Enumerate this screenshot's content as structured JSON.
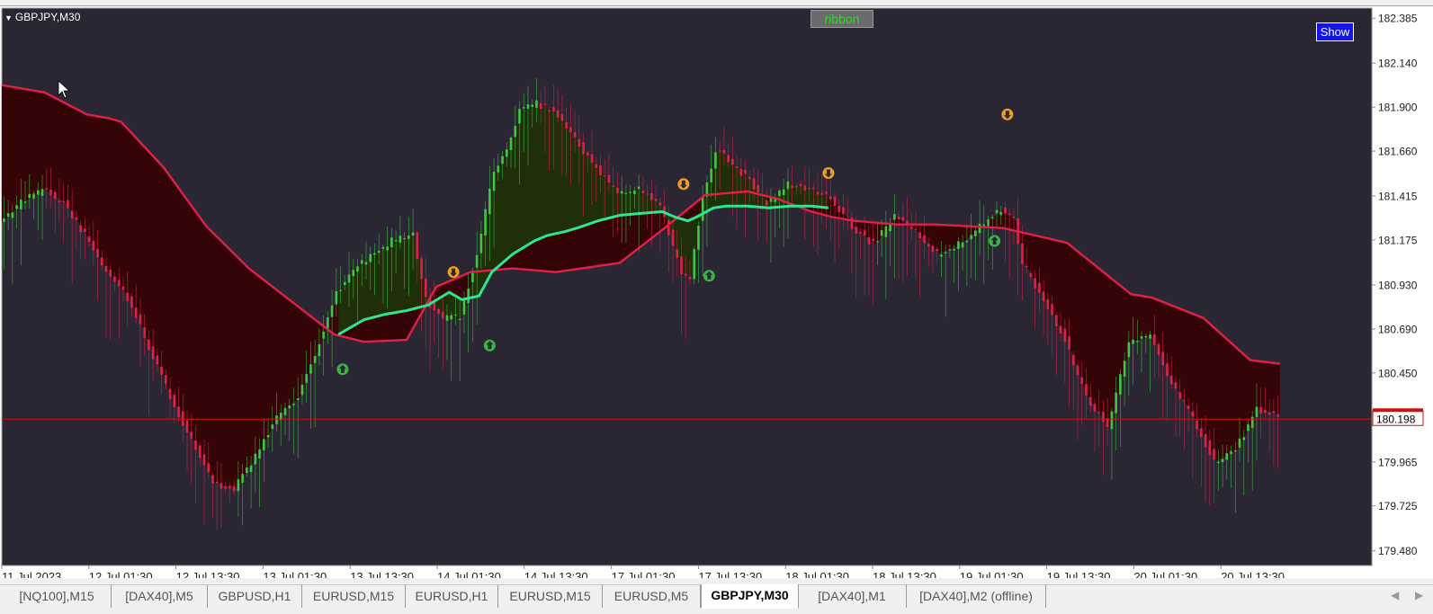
{
  "window": {
    "symbol_label": "GBPJPY,M30",
    "ribbon_label": "ribbon",
    "show_label": "Show"
  },
  "colors": {
    "background": "#2a2633",
    "bull": "#3fc83f",
    "bear": "#e0204a",
    "bear_fill": "#360204",
    "bull_fill": "#1d310a",
    "ma_line": "#2ee690",
    "signal_up": "#f0a020",
    "signal_down": "#3ab54a",
    "price_line": "#d01010"
  },
  "tabs": [
    {
      "label": "[NQ100],M15",
      "active": false
    },
    {
      "label": "[DAX40],M5",
      "active": false
    },
    {
      "label": "GBPUSD,H1",
      "active": false
    },
    {
      "label": "EURUSD,M15",
      "active": false
    },
    {
      "label": "EURUSD,H1",
      "active": false
    },
    {
      "label": "EURUSD,M15",
      "active": false
    },
    {
      "label": "EURUSD,M5",
      "active": false
    },
    {
      "label": "GBPJPY,M30",
      "active": true
    },
    {
      "label": "[DAX40],M1",
      "active": false
    },
    {
      "label": "[DAX40],M2 (offline)",
      "active": false
    }
  ],
  "chart_data": {
    "type": "line",
    "y_ticks": [
      "182.385",
      "182.140",
      "181.900",
      "181.660",
      "181.415",
      "181.175",
      "180.930",
      "180.690",
      "180.450",
      "179.965",
      "179.725",
      "179.480"
    ],
    "ylim": [
      179.4,
      182.44
    ],
    "x_ticks": [
      "11 Jul 2023",
      "12 Jul 01:30",
      "12 Jul 13:30",
      "13 Jul 01:30",
      "13 Jul 13:30",
      "14 Jul 01:30",
      "14 Jul 13:30",
      "17 Jul 01:30",
      "17 Jul 13:30",
      "18 Jul 01:30",
      "18 Jul 13:30",
      "19 Jul 01:30",
      "19 Jul 13:30",
      "20 Jul 01:30",
      "20 Jul 13:30"
    ],
    "current_price": "180.198",
    "current_price_value": 180.198,
    "x_count": 300,
    "series": [
      {
        "role": "upper_band",
        "x": [
          0,
          10,
          20,
          25,
          28,
          38,
          48,
          58,
          68,
          78,
          85,
          95,
          102,
          110,
          120,
          130,
          145,
          155,
          165,
          175,
          182,
          190,
          195,
          200,
          210,
          219,
          235,
          250,
          265,
          270,
          282,
          293,
          300
        ],
        "values": [
          182.02,
          181.98,
          181.86,
          181.84,
          181.82,
          181.57,
          181.25,
          181.02,
          180.84,
          180.66,
          180.62,
          180.63,
          180.92,
          181.0,
          181.02,
          181.0,
          181.05,
          181.23,
          181.42,
          181.44,
          181.4,
          181.33,
          181.3,
          181.28,
          181.26,
          181.26,
          181.24,
          181.16,
          180.88,
          180.86,
          180.75,
          180.52,
          180.5
        ]
      },
      {
        "role": "fast_ma",
        "x": [
          0,
          5,
          10,
          15,
          20,
          25,
          30,
          40,
          50,
          55,
          60,
          65,
          70,
          75,
          79,
          83,
          87,
          92,
          97,
          100,
          104,
          108,
          112,
          116,
          120,
          122,
          126,
          130,
          135,
          140,
          145,
          150,
          155,
          160,
          162,
          165,
          168,
          170,
          175,
          180,
          185,
          190,
          195,
          200,
          205,
          210,
          215,
          220,
          225,
          230,
          235,
          238,
          240,
          245,
          250,
          255,
          260,
          265,
          270,
          275,
          280,
          285,
          290,
          295,
          300
        ],
        "values": [
          181.27,
          181.38,
          181.45,
          181.38,
          181.2,
          181.0,
          180.86,
          180.32,
          179.85,
          179.82,
          180.0,
          180.21,
          180.32,
          180.62,
          180.88,
          181.02,
          181.08,
          181.17,
          181.2,
          180.85,
          180.75,
          180.75,
          181.1,
          181.55,
          181.72,
          181.88,
          181.92,
          181.88,
          181.72,
          181.57,
          181.43,
          181.45,
          181.36,
          181.0,
          180.98,
          181.4,
          181.67,
          181.63,
          181.52,
          181.38,
          181.48,
          181.45,
          181.4,
          181.25,
          181.15,
          181.3,
          181.22,
          181.1,
          181.15,
          181.25,
          181.34,
          181.28,
          181.05,
          180.85,
          180.63,
          180.32,
          180.15,
          180.62,
          180.65,
          180.4,
          180.2,
          179.97,
          180.03,
          180.25,
          180.23
        ]
      },
      {
        "role": "slow_ma",
        "x": [
          79,
          85,
          90,
          95,
          100,
          105,
          108,
          112,
          115,
          120,
          125,
          128,
          132,
          135,
          140,
          145,
          150,
          155,
          158,
          161,
          163,
          167,
          170,
          175,
          180,
          185,
          190,
          194
        ],
        "values": [
          180.66,
          180.74,
          180.77,
          180.79,
          180.82,
          180.89,
          180.85,
          180.87,
          181.0,
          181.1,
          181.17,
          181.2,
          181.22,
          181.24,
          181.28,
          181.31,
          181.32,
          181.33,
          181.3,
          181.28,
          181.3,
          181.35,
          181.36,
          181.36,
          181.35,
          181.36,
          181.36,
          181.35
        ]
      }
    ],
    "signals": [
      {
        "type": "sell",
        "x": 106,
        "y": 181.0
      },
      {
        "type": "buy",
        "x": 114.5,
        "y": 180.6
      },
      {
        "type": "sell",
        "x": 160,
        "y": 181.48
      },
      {
        "type": "buy",
        "x": 166,
        "y": 180.98
      },
      {
        "type": "sell",
        "x": 194,
        "y": 181.54
      },
      {
        "type": "buy",
        "x": 233,
        "y": 181.17
      },
      {
        "type": "sell",
        "x": 236,
        "y": 181.86
      },
      {
        "type": "buy",
        "x": 80,
        "y": 180.47
      }
    ]
  }
}
